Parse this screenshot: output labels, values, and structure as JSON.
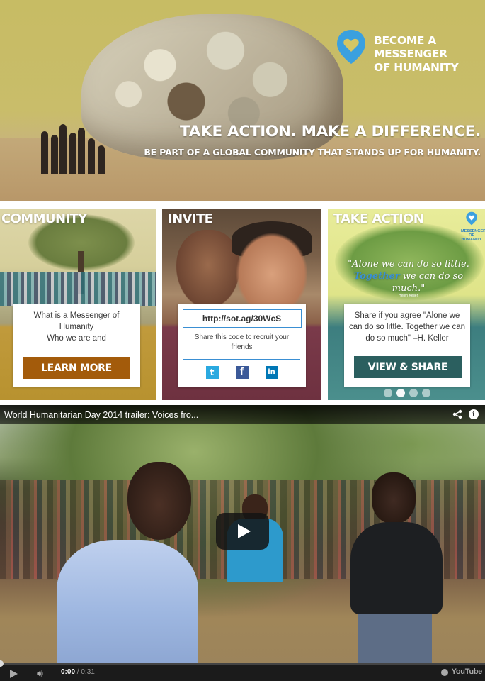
{
  "hero": {
    "logo_text": "BECOME A MESSENGER\nOF HUMANITY",
    "logo_line1": "BECOME A MESSENGER",
    "logo_line2": "OF HUMANITY",
    "headline": "TAKE ACTION. MAKE A DIFFERENCE.",
    "subheadline": "BE PART OF A GLOBAL COMMUNITY THAT STANDS UP FOR HUMANITY.",
    "logo_icon": "heart-pin-icon"
  },
  "tiles": {
    "community": {
      "title": "COMMUNITY",
      "line1": "What is a Messenger of",
      "line2": "Humanity",
      "line3": "Who we are and",
      "button": "LEARN MORE",
      "button_color": "#a35b0b"
    },
    "invite": {
      "title": "INVITE",
      "code": "http://sot.ag/30WcS",
      "description": "Share this code to recruit your friends",
      "social": [
        "twitter-icon",
        "facebook-icon",
        "linkedin-icon"
      ]
    },
    "take_action": {
      "title": "TAKE ACTION",
      "quote_line1": "\"Alone we can do so little.",
      "quote_word": "Together",
      "quote_line2_rest": " we can do so much.\"",
      "quote_author": "Helen Keller",
      "logo_text": "MESSENGERS OF HUMANITY",
      "share_text": "Share if you agree \"Alone we can do so little. Together we can do so much\" –H. Keller",
      "button": "VIEW & SHARE",
      "button_color": "#2b5f5f",
      "carousel_dots": 4,
      "carousel_active": 1
    }
  },
  "video": {
    "title": "World Humanitarian Day 2014 trailer: Voices fro...",
    "current_time": "0:00",
    "duration": "/ 0:31",
    "progress": 0,
    "brand": "YouTube"
  }
}
